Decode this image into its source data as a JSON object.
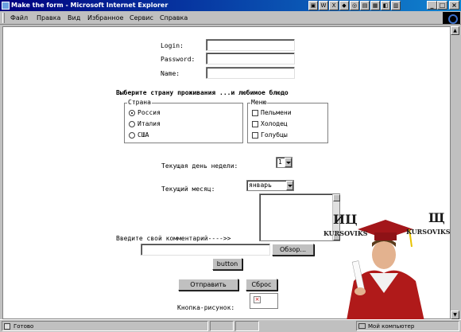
{
  "window": {
    "title": "Make the form - Microsoft Internet Explorer"
  },
  "menu": {
    "items": [
      "Файл",
      "Правка",
      "Вид",
      "Избранное",
      "Сервис",
      "Справка"
    ]
  },
  "form": {
    "login_label": "Login:",
    "password_label": "Password:",
    "name_label": "Name:",
    "choose_heading": "Выберите страну проживания ...и любимое блюдо",
    "country_legend": "Страна",
    "countries": [
      "Россия",
      "Италия",
      "США"
    ],
    "selected_country": "Россия",
    "menu_legend": "Меню",
    "dishes": [
      "Пельмени",
      "Холодец",
      "Голубцы"
    ],
    "weekday_label": "Текущая день недели:",
    "weekday_value": "1",
    "month_label": "Текущий месяц:",
    "month_value": "январь",
    "comment_label": "Введите свой комментарий---->>",
    "browse_label": "Обзор...",
    "button_label": "button",
    "submit_label": "Отправить",
    "reset_label": "Сброс",
    "image_button_label": "Кнопка-рисунок:"
  },
  "watermark": {
    "left_text": "ИЦ",
    "left_sub": "KURSOVIKS",
    "right_text": "Щ",
    "right_sub": "KURSOVIKS"
  },
  "status": {
    "text": "Готово",
    "zone": "Мой компьютер"
  }
}
